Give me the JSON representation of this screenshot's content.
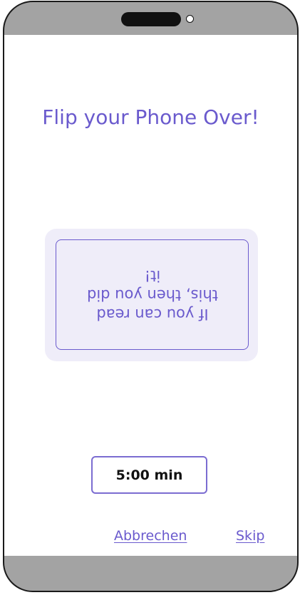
{
  "screen": {
    "title": "Flip your Phone Over!",
    "card_message": "If you can read this, then you did it!",
    "timer": "5:00 min",
    "cancel_label": "Abbrechen",
    "skip_label": "Skip"
  },
  "colors": {
    "accent": "#6a5acd",
    "card_background": "#efedf9",
    "phone_frame": "#a3a3a3"
  }
}
